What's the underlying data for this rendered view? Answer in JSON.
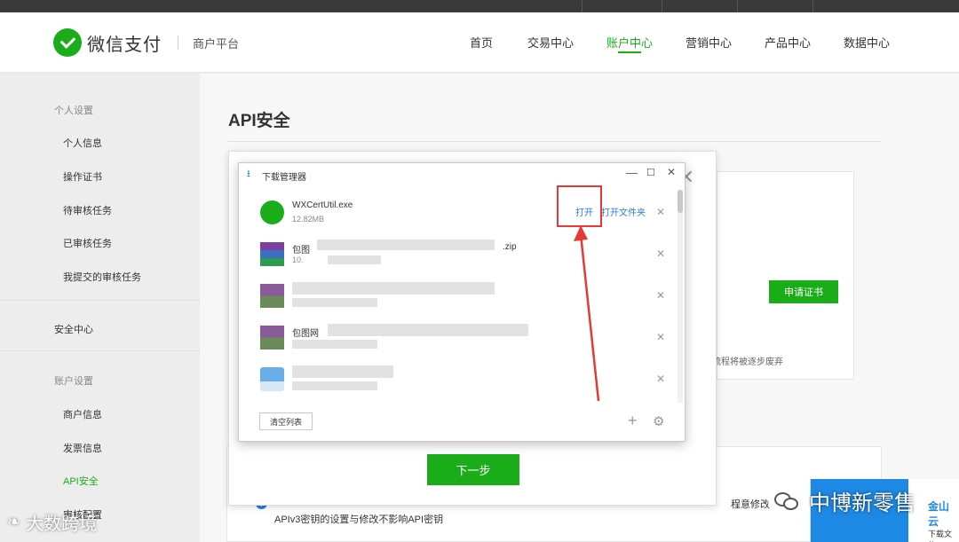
{
  "header": {
    "brand": "微信支付",
    "subtitle": "商户平台",
    "nav": [
      {
        "label": "首页",
        "active": false
      },
      {
        "label": "交易中心",
        "active": false
      },
      {
        "label": "账户中心",
        "active": true
      },
      {
        "label": "营销中心",
        "active": false
      },
      {
        "label": "产品中心",
        "active": false
      },
      {
        "label": "数据中心",
        "active": false
      }
    ]
  },
  "sidebar": {
    "group_personal": "个人设置",
    "personal_items": [
      "个人信息",
      "操作证书",
      "待审核任务",
      "已审核任务",
      "我提交的审核任务"
    ],
    "security_center": "安全中心",
    "group_account": "账户设置",
    "account_items": [
      "商户信息",
      "发票信息",
      "API安全",
      "审核配置"
    ],
    "active_item": "API安全"
  },
  "main": {
    "page_title": "API安全",
    "apply_cert_label": "申请证书",
    "deprecate_text": "的流程将被逐步废弃",
    "info_text": "APIv3密钥的设置与修改不影响API密钥",
    "partial_text": "程意修改。 查"
  },
  "dialog": {
    "close_symbol": "✕",
    "next_label": "下一步"
  },
  "download_manager": {
    "title": "下载管理器",
    "controls": [
      "—",
      "☐",
      "✕"
    ],
    "files": [
      {
        "name": "WXCertUtil.exe",
        "size": "12.82MB",
        "open_label": "打开",
        "open_folder_label": "打开文件夹"
      },
      {
        "name": "包图",
        "ext": ".zip",
        "size": "10."
      },
      {
        "name": "",
        "size": ""
      },
      {
        "name": "包图网",
        "size": ""
      },
      {
        "name": "",
        "size": ""
      }
    ],
    "close_row_symbol": "✕",
    "clear_label": "清空列表",
    "plus_symbol": "+",
    "gear_symbol": "⚙"
  },
  "watermarks": {
    "left": "大数跨境",
    "right": "中博新零售",
    "ad_brand": "金山云",
    "ad_hint": "下载文件"
  },
  "colors": {
    "brand_green": "#1aad19",
    "link_blue": "#2a7ae2",
    "highlight_red": "#e53935"
  }
}
